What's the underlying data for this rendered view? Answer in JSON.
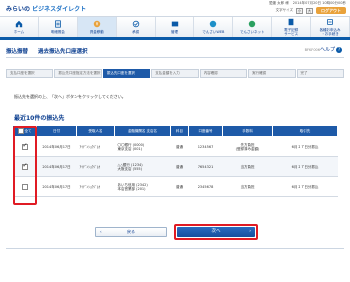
{
  "header": {
    "logo_prefix": "みらいの",
    "logo_brand": "ビジネスダイレクト",
    "user_name_label": "愛媛 太郎 様",
    "last_login": "2014年07月20日 10時00分00秒",
    "font_size_label": "文字サイズ",
    "font_small": "小",
    "font_large": "大",
    "logout_label": "ログアウト"
  },
  "nav": [
    {
      "label": "ホーム",
      "icon": "home-icon",
      "active": false
    },
    {
      "label": "明細照会",
      "icon": "statement-icon",
      "active": false
    },
    {
      "label": "資金移動",
      "icon": "transfer-icon",
      "active": true
    },
    {
      "label": "承認",
      "icon": "approval-icon",
      "active": false
    },
    {
      "label": "管理",
      "icon": "management-icon",
      "active": false
    },
    {
      "label": "でんさいWEB",
      "icon": "densai-icon",
      "active": false
    },
    {
      "label": "でんさいネット",
      "icon": "densai-net-icon",
      "active": false
    },
    {
      "label": "電子記録\nサービス",
      "icon": "e-record-icon",
      "active": false
    },
    {
      "label": "各種お申込み\n・お手続き",
      "icon": "application-icon",
      "active": false
    }
  ],
  "title": {
    "parent": "振込振替",
    "page": "過去振込先口座選択",
    "screen_id": "BFKF006",
    "help": "ヘルプ"
  },
  "steps": [
    "支払口座を選択",
    "振込先口座指定方法を選択",
    "振込先口座を選択",
    "支払金額を入力",
    "内容確認",
    "実行確認",
    "完了"
  ],
  "active_step": 2,
  "instruction": "振込先を選択の上、「次へ」ボタンをクリックしてください。",
  "section_title": "最近10件の振込先",
  "table": {
    "headers": [
      "全て",
      "日付",
      "受取人名",
      "金融機関名\n支店名",
      "科目",
      "口座番号",
      "手数料",
      "取引先"
    ],
    "rows": [
      {
        "checked": true,
        "date": "2014年06月17日",
        "payee": "ｱｲﾃﾞﾝｼｮｳｼﾞ(ｶ",
        "bank": "〇〇銀行 (0000)\n東京支店 (001)",
        "type": "普通",
        "account": "1234567",
        "fee": "先方負担\n(登録済み金額)",
        "partner": "6月１７日分振込"
      },
      {
        "checked": true,
        "date": "2014年06月17日",
        "payee": "ｱｲﾃﾞﾝｼｮｳｼﾞ(ｶ",
        "bank": "△△銀行 (1234)\n大阪支店 (555)",
        "type": "普通",
        "account": "7654321",
        "fee": "当方負担",
        "partner": "6月１７日分振込"
      },
      {
        "checked": false,
        "date": "2014年06月17日",
        "payee": "ｱｲﾃﾞﾝｼｮｳｼﾞ(ｶ",
        "bank": "あいち信用 (2342)\n本店営業部 (201)",
        "type": "普通",
        "account": "2345678",
        "fee": "当方負担",
        "partner": "6月１７日分振込"
      }
    ]
  },
  "buttons": {
    "back": "戻る",
    "next": "次へ"
  },
  "pagetop": "ページの先頭に戻る",
  "colors": {
    "primary": "#1e5aa8",
    "highlight": "#e01b24",
    "logout": "#e9a23b"
  }
}
